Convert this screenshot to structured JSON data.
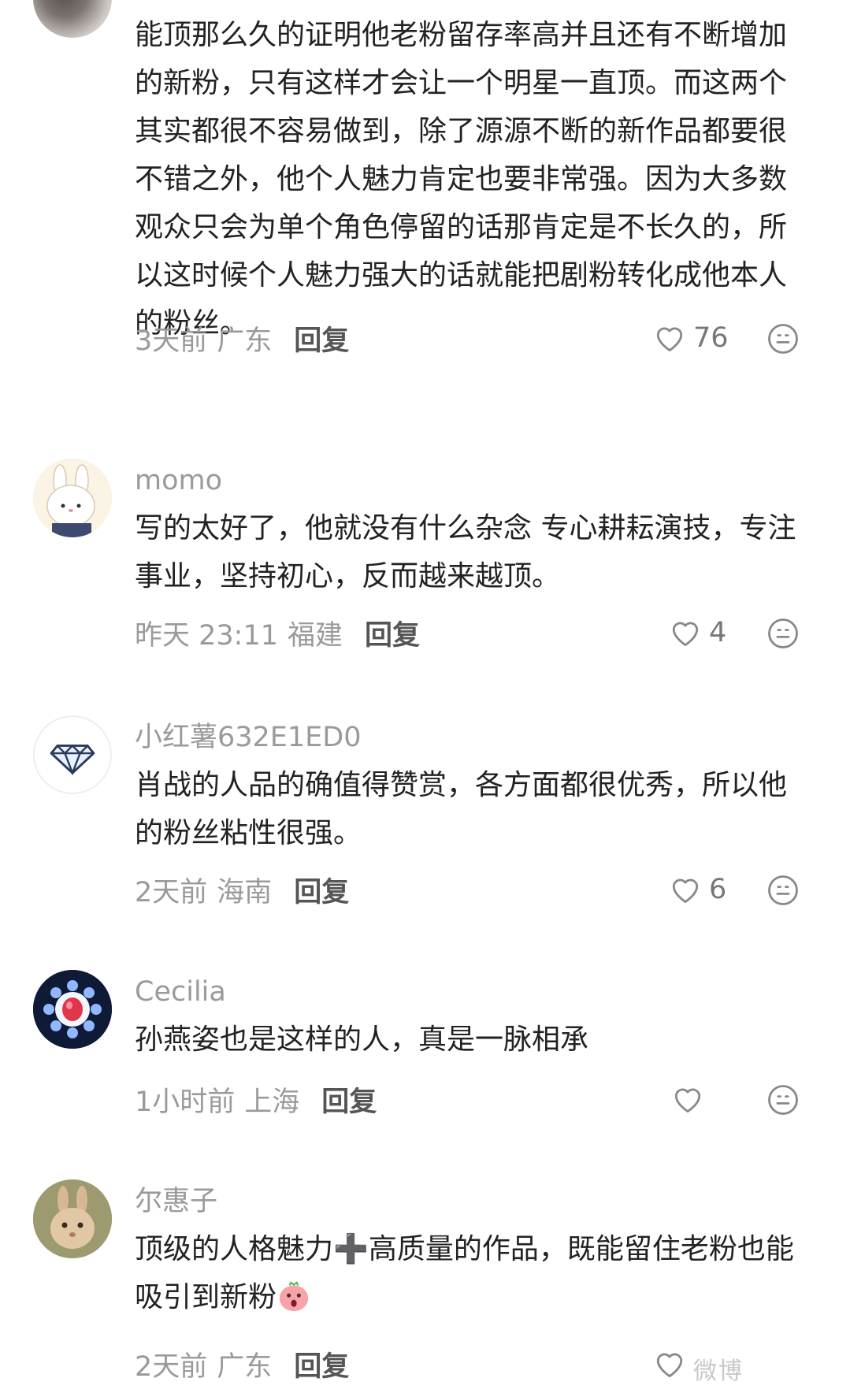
{
  "comments": [
    {
      "username": "",
      "text": "能顶那么久的证明他老粉留存率高并且还有不断增加的新粉，只有这样才会让一个明星一直顶。而这两个其实都很不容易做到，除了源源不断的新作品都要很不错之外，他个人魅力肯定也要非常强。因为大多数观众只会为单个角色停留的话那肯定是不长久的，所以这时候个人魅力强大的话就能把剧粉转化成他本人的粉丝。",
      "time": "3天前",
      "location": "广东",
      "reply": "回复",
      "likes": "76"
    },
    {
      "username": "momo",
      "text": "写的太好了，他就没有什么杂念 专心耕耘演技，专注事业，坚持初心，反而越来越顶。",
      "time": "昨天 23:11",
      "location": "福建",
      "reply": "回复",
      "likes": "4"
    },
    {
      "username": "小红薯632E1ED0",
      "text": "肖战的人品的确值得赞赏，各方面都很优秀，所以他的粉丝粘性很强。",
      "time": "2天前",
      "location": "海南",
      "reply": "回复",
      "likes": "6"
    },
    {
      "username": "Cecilia",
      "text": "孙燕姿也是这样的人，真是一脉相承",
      "time": "1小时前",
      "location": "上海",
      "reply": "回复",
      "likes": ""
    },
    {
      "username": "尔惠子",
      "text": "顶级的人格魅力➕高质量的作品，既能留住老粉也能吸引到新粉",
      "time": "2天前",
      "location": "广东",
      "reply": "回复",
      "likes": ""
    }
  ],
  "icons": {
    "like": "heart-outline-icon",
    "emoji": "smiley-icon",
    "plus": "plus-emoji",
    "surprised": "surprised-face-emoji"
  },
  "watermark": "微博",
  "colors": {
    "meta": "#9a9a9a",
    "text": "#222222",
    "reply": "#555555"
  }
}
